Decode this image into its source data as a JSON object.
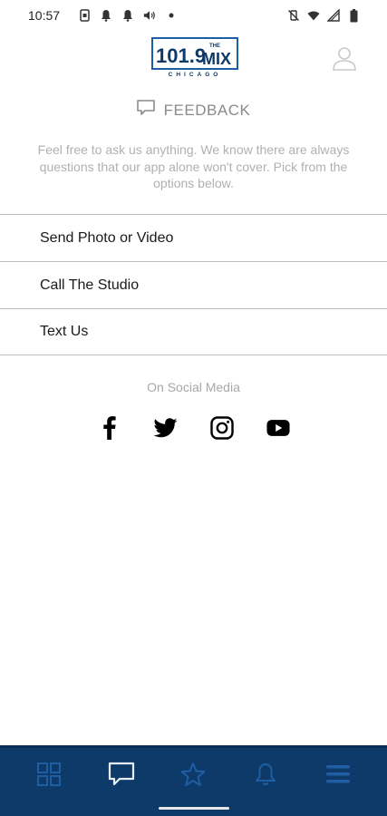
{
  "status_bar": {
    "time": "10:57",
    "left_icons": [
      "sim-card-icon",
      "notification-bell-icon",
      "notification-bell-icon",
      "volume-icon",
      "dot-icon"
    ],
    "right_icons": [
      "vibrate-off-icon",
      "wifi-icon",
      "signal-icon",
      "battery-icon"
    ]
  },
  "header": {
    "logo": {
      "frequency": "101.9",
      "the": "THE",
      "name": "MIX",
      "city": "CHICAGO"
    },
    "profile_icon": "user-icon"
  },
  "feedback": {
    "title": "FEEDBACK",
    "intro": "Feel free to ask us anything. We know there are always questions that our app alone won't cover. Pick from the options below."
  },
  "options": [
    {
      "label": "Send Photo or Video"
    },
    {
      "label": "Call The Studio"
    },
    {
      "label": "Text Us"
    }
  ],
  "social": {
    "label": "On Social Media",
    "icons": [
      "facebook-icon",
      "twitter-icon",
      "instagram-icon",
      "youtube-icon"
    ]
  },
  "bottom_nav": {
    "background": "#0d3a68",
    "icon_color": "#1f5ea3",
    "active_icon_color": "#e8edf3",
    "items": [
      "grid-icon",
      "chat-icon",
      "star-icon",
      "bell-icon",
      "menu-icon"
    ],
    "active_index": 1
  }
}
